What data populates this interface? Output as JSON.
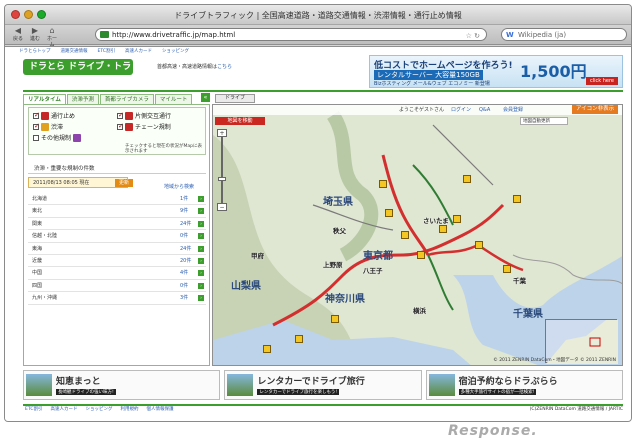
{
  "window": {
    "title": "ドライブトラフィック | 全国高速道路・道路交通情報・渋滞情報・通行止め情報"
  },
  "toolbar": {
    "back_label": "戻る",
    "forward_label": "進む",
    "home_label": "ホーム",
    "url": "http://www.drivetraffic.jp/map.html",
    "search_placeholder": "Wikipedia (ja)"
  },
  "site": {
    "top_links": [
      "ドラとらトップ",
      "道路交通情報",
      "ETC割引",
      "高速人カード",
      "ショッピング"
    ],
    "logo": "ドラとら ドライブ・トラフィック",
    "subtext": "首都高速・高速道路情報は",
    "subtext_link": "こちら"
  },
  "ad": {
    "headline": "低コストでホームページを作ろう!",
    "badge": "レンタルサーバー 大容量150GB",
    "price": "1,500円",
    "sub": "Bizホスティング メール&ウェブ エコノミー 新登場",
    "button": "click here"
  },
  "tabs": [
    {
      "label": "リアルタイム",
      "active": true
    },
    {
      "label": "渋滞予測",
      "active": false
    },
    {
      "label": "首都ライブカメラ",
      "active": false
    },
    {
      "label": "マイルート",
      "active": false
    }
  ],
  "drive_button": "ドライブ",
  "legend": {
    "items": [
      {
        "label": "通行止め",
        "checked": true,
        "color": "#c62828"
      },
      {
        "label": "片側交互通行",
        "checked": true,
        "color": "#c62828"
      },
      {
        "label": "渋滞",
        "checked": true,
        "color": "#e0a020"
      },
      {
        "label": "チェーン規制",
        "checked": true,
        "color": "#c62828"
      },
      {
        "label": "その他規制",
        "checked": false,
        "color": "#8e44ad"
      }
    ],
    "note": "チェックすると現在の状況がMapに表示されます"
  },
  "panel": {
    "title": "渋滞・重要な規制の件数",
    "date": "2011/08/13 08:05 現在",
    "update_button": "更新",
    "region_link": "地域から検索",
    "rows": [
      {
        "region": "北海道",
        "count": "1件"
      },
      {
        "region": "東北",
        "count": "9件"
      },
      {
        "region": "関東",
        "count": "24件"
      },
      {
        "region": "信越・北陸",
        "count": "0件"
      },
      {
        "region": "東海",
        "count": "24件"
      },
      {
        "region": "近畿",
        "count": "20件"
      },
      {
        "region": "中国",
        "count": "4件"
      },
      {
        "region": "四国",
        "count": "0件"
      },
      {
        "region": "九州・沖縄",
        "count": "3件"
      }
    ]
  },
  "map": {
    "welcome": "ようこそゲストさん",
    "links": [
      "ログイン",
      "Q&A",
      "会員登録"
    ],
    "icon_button": "アイコン非表示",
    "checkbox_label": "地図自動更新",
    "red_button": "地図を移動",
    "prefectures": [
      "埼玉県",
      "東京都",
      "神奈川県",
      "山梨県",
      "千葉県"
    ],
    "cities": [
      "さいたま",
      "甲府",
      "千葉",
      "横浜",
      "上野原",
      "八王子",
      "秩父"
    ],
    "copyright": "© 2011 ZENRIN DataCom・地図データ © 2011 ZENRIN"
  },
  "banners": [
    {
      "big": "知恵まっと",
      "small": "長崎観ドライブの強い味方!"
    },
    {
      "big": "レンタカーでドライブ旅行",
      "small": "レンタカーでドライブ旅行を楽しもう!"
    },
    {
      "big": "宿泊予約ならドラぷらら",
      "small": "多種大手旅行サイトの宿が一括検索!"
    }
  ],
  "footer": {
    "links": [
      "ETC割引",
      "高速人カード",
      "ショッピング",
      "利用規約",
      "個人情報保護"
    ],
    "copyright": "(C)ZENRIN DataCom  道路交通情報 / JARTIC"
  },
  "watermark": "Response."
}
